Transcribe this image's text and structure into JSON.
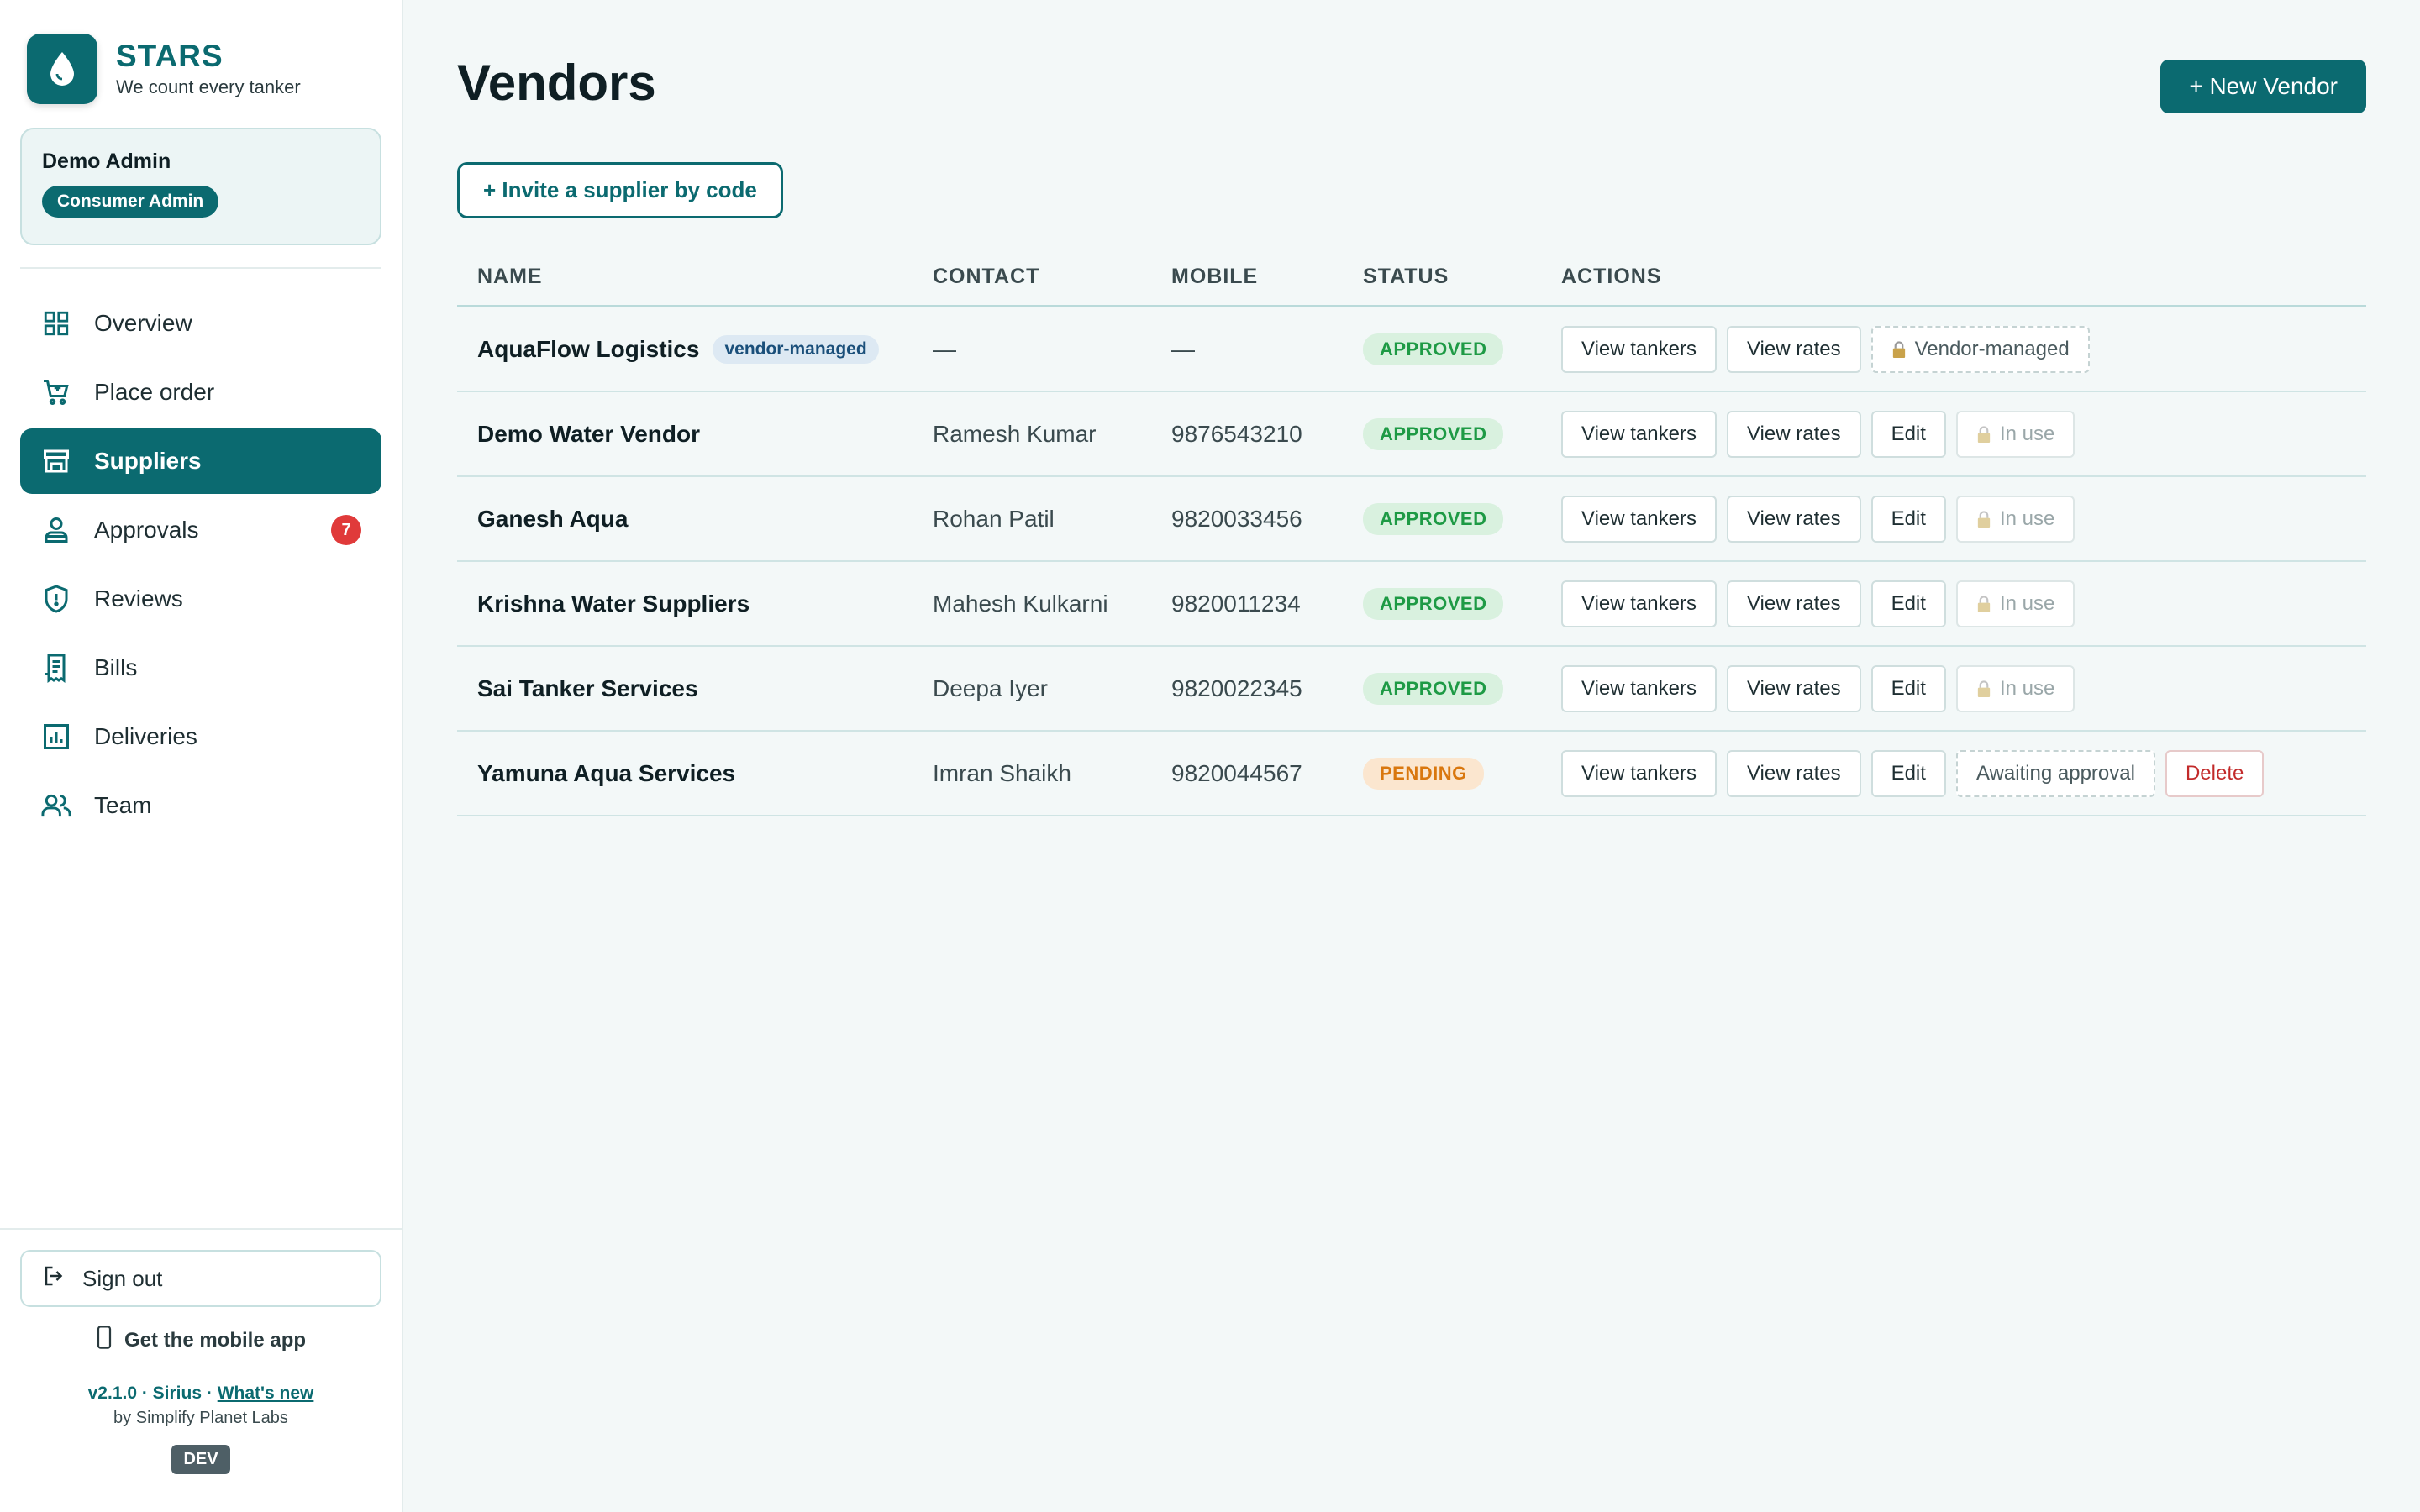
{
  "brand": {
    "name": "STARS",
    "tagline": "We count every tanker",
    "color": "#0b6a70"
  },
  "user": {
    "name": "Demo Admin",
    "role": "Consumer Admin"
  },
  "nav": [
    {
      "label": "Overview",
      "icon": "grid-icon",
      "active": false
    },
    {
      "label": "Place order",
      "icon": "cart-icon",
      "active": false
    },
    {
      "label": "Suppliers",
      "icon": "store-icon",
      "active": true
    },
    {
      "label": "Approvals",
      "icon": "user-check-icon",
      "active": false,
      "badge": "7"
    },
    {
      "label": "Reviews",
      "icon": "shield-icon",
      "active": false
    },
    {
      "label": "Bills",
      "icon": "receipt-icon",
      "active": false
    },
    {
      "label": "Deliveries",
      "icon": "bar-chart-icon",
      "active": false
    },
    {
      "label": "Team",
      "icon": "users-icon",
      "active": false
    }
  ],
  "footer": {
    "signout": "Sign out",
    "mobile_app": "Get the mobile app",
    "version": "v2.1.0 · Sirius · ",
    "whats_new": "What's new",
    "byline": "by Simplify Planet Labs",
    "env": "DEV"
  },
  "page": {
    "title": "Vendors",
    "new_vendor": "+ New Vendor",
    "invite": "+ Invite a supplier by code"
  },
  "table": {
    "headers": {
      "name": "NAME",
      "contact": "CONTACT",
      "mobile": "MOBILE",
      "status": "STATUS",
      "actions": "ACTIONS"
    },
    "rows": [
      {
        "name": "AquaFlow Logistics",
        "tag": "vendor-managed",
        "contact": "—",
        "mobile": "—",
        "status": "APPROVED",
        "actions": [
          "View tankers",
          "View rates",
          "Vendor-managed"
        ]
      },
      {
        "name": "Demo Water Vendor",
        "contact": "Ramesh Kumar",
        "mobile": "9876543210",
        "status": "APPROVED",
        "actions": [
          "View tankers",
          "View rates",
          "Edit",
          "In use"
        ]
      },
      {
        "name": "Ganesh Aqua",
        "contact": "Rohan Patil",
        "mobile": "9820033456",
        "status": "APPROVED",
        "actions": [
          "View tankers",
          "View rates",
          "Edit",
          "In use"
        ]
      },
      {
        "name": "Krishna Water Suppliers",
        "contact": "Mahesh Kulkarni",
        "mobile": "9820011234",
        "status": "APPROVED",
        "actions": [
          "View tankers",
          "View rates",
          "Edit",
          "In use"
        ]
      },
      {
        "name": "Sai Tanker Services",
        "contact": "Deepa Iyer",
        "mobile": "9820022345",
        "status": "APPROVED",
        "actions": [
          "View tankers",
          "View rates",
          "Edit",
          "In use"
        ]
      },
      {
        "name": "Yamuna Aqua Services",
        "contact": "Imran Shaikh",
        "mobile": "9820044567",
        "status": "PENDING",
        "actions": [
          "View tankers",
          "View rates",
          "Edit",
          "Awaiting approval",
          "Delete"
        ]
      }
    ]
  }
}
